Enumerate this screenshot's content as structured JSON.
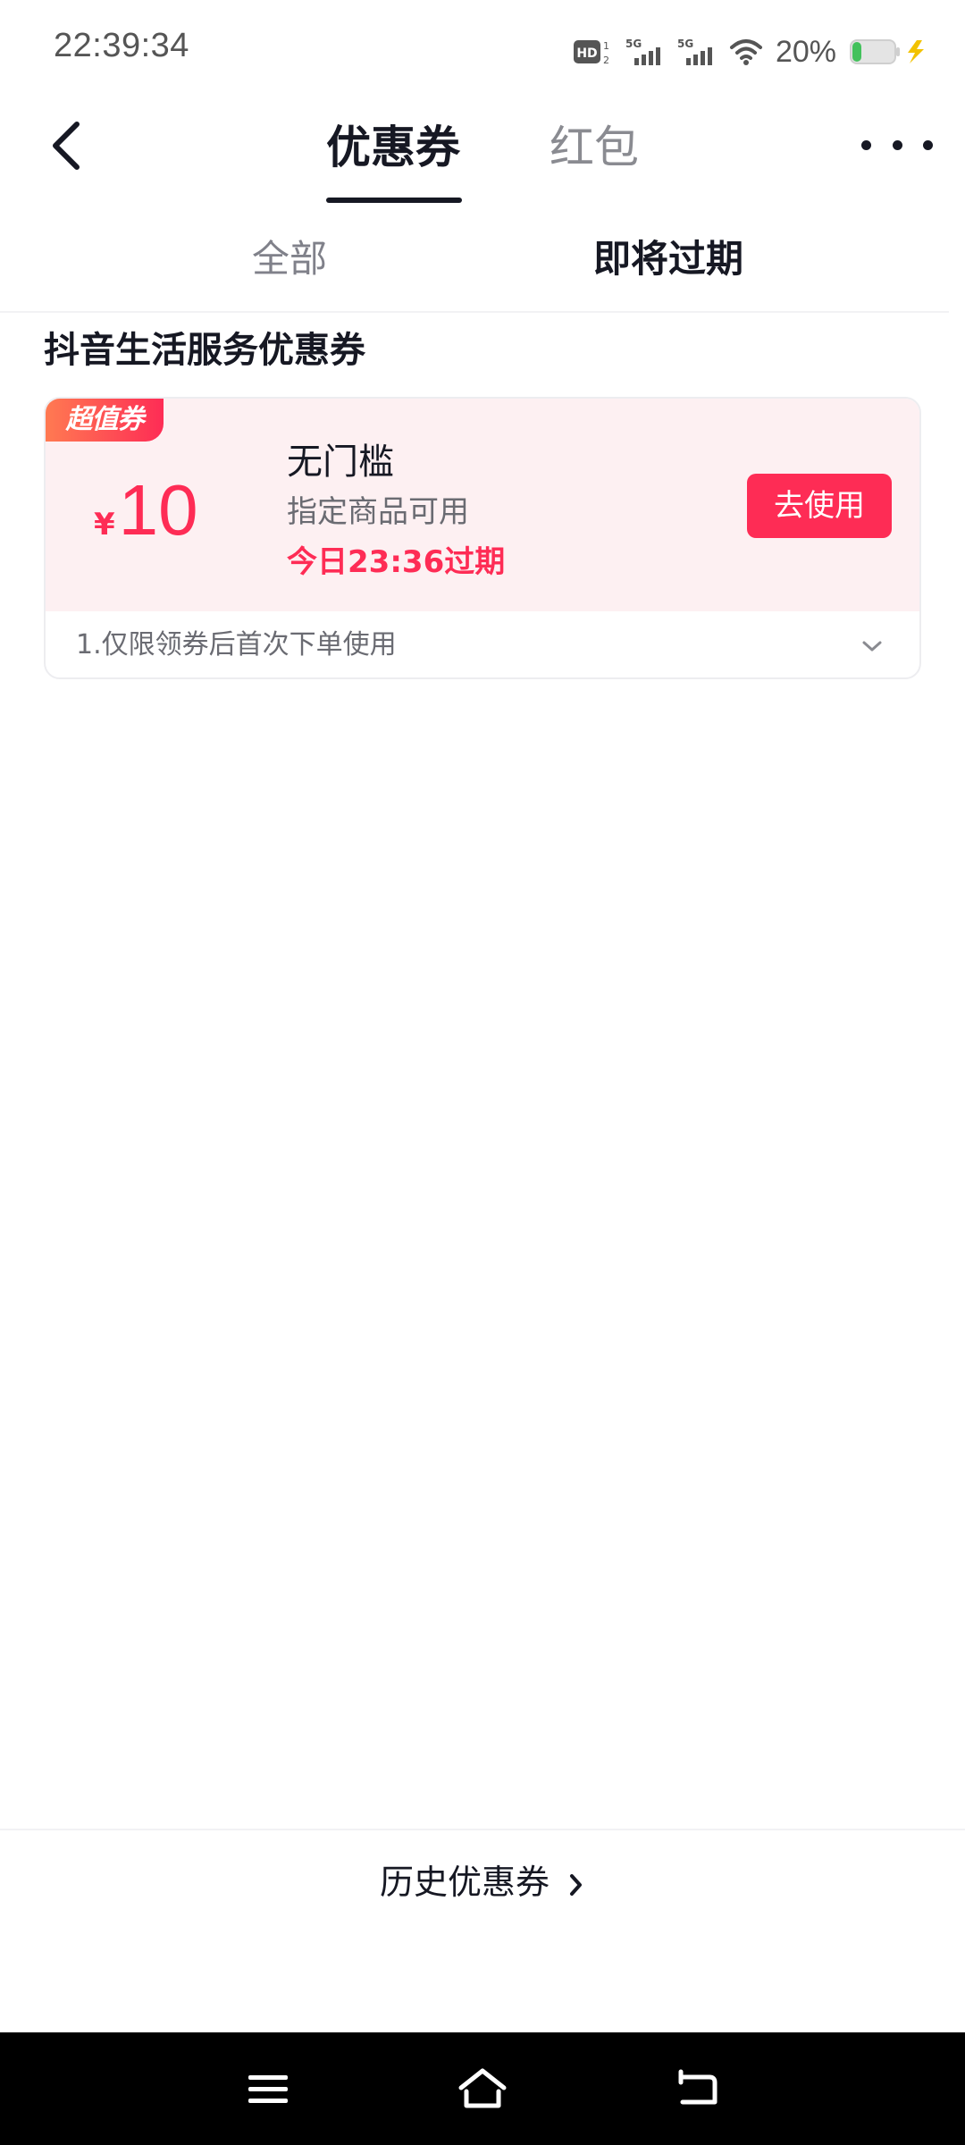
{
  "status_bar": {
    "time": "22:39:34",
    "hd_label": "HD",
    "net1": "5G",
    "net2": "5G",
    "battery": "20%"
  },
  "header": {
    "tabs": [
      {
        "label": "优惠券",
        "active": true
      },
      {
        "label": "红包",
        "active": false
      }
    ]
  },
  "filters": [
    {
      "label": "全部",
      "active": false
    },
    {
      "label": "即将过期",
      "active": true
    }
  ],
  "section": {
    "title": "抖音生活服务优惠券"
  },
  "coupon": {
    "badge": "超值券",
    "currency": "¥",
    "amount": "10",
    "title": "无门槛",
    "description": "指定商品可用",
    "expire": "今日23:36过期",
    "button": "去使用",
    "rule": "1.仅限领券后首次下单使用"
  },
  "footer": {
    "history_link": "历史优惠券"
  },
  "colors": {
    "accent": "#fe2c55",
    "card_bg": "#fdf0f2",
    "text": "#161823"
  },
  "icons": {
    "back": "back-arrow-icon",
    "more": "more-icon",
    "expand": "chevron-down-icon",
    "history": "chevron-right-icon"
  }
}
